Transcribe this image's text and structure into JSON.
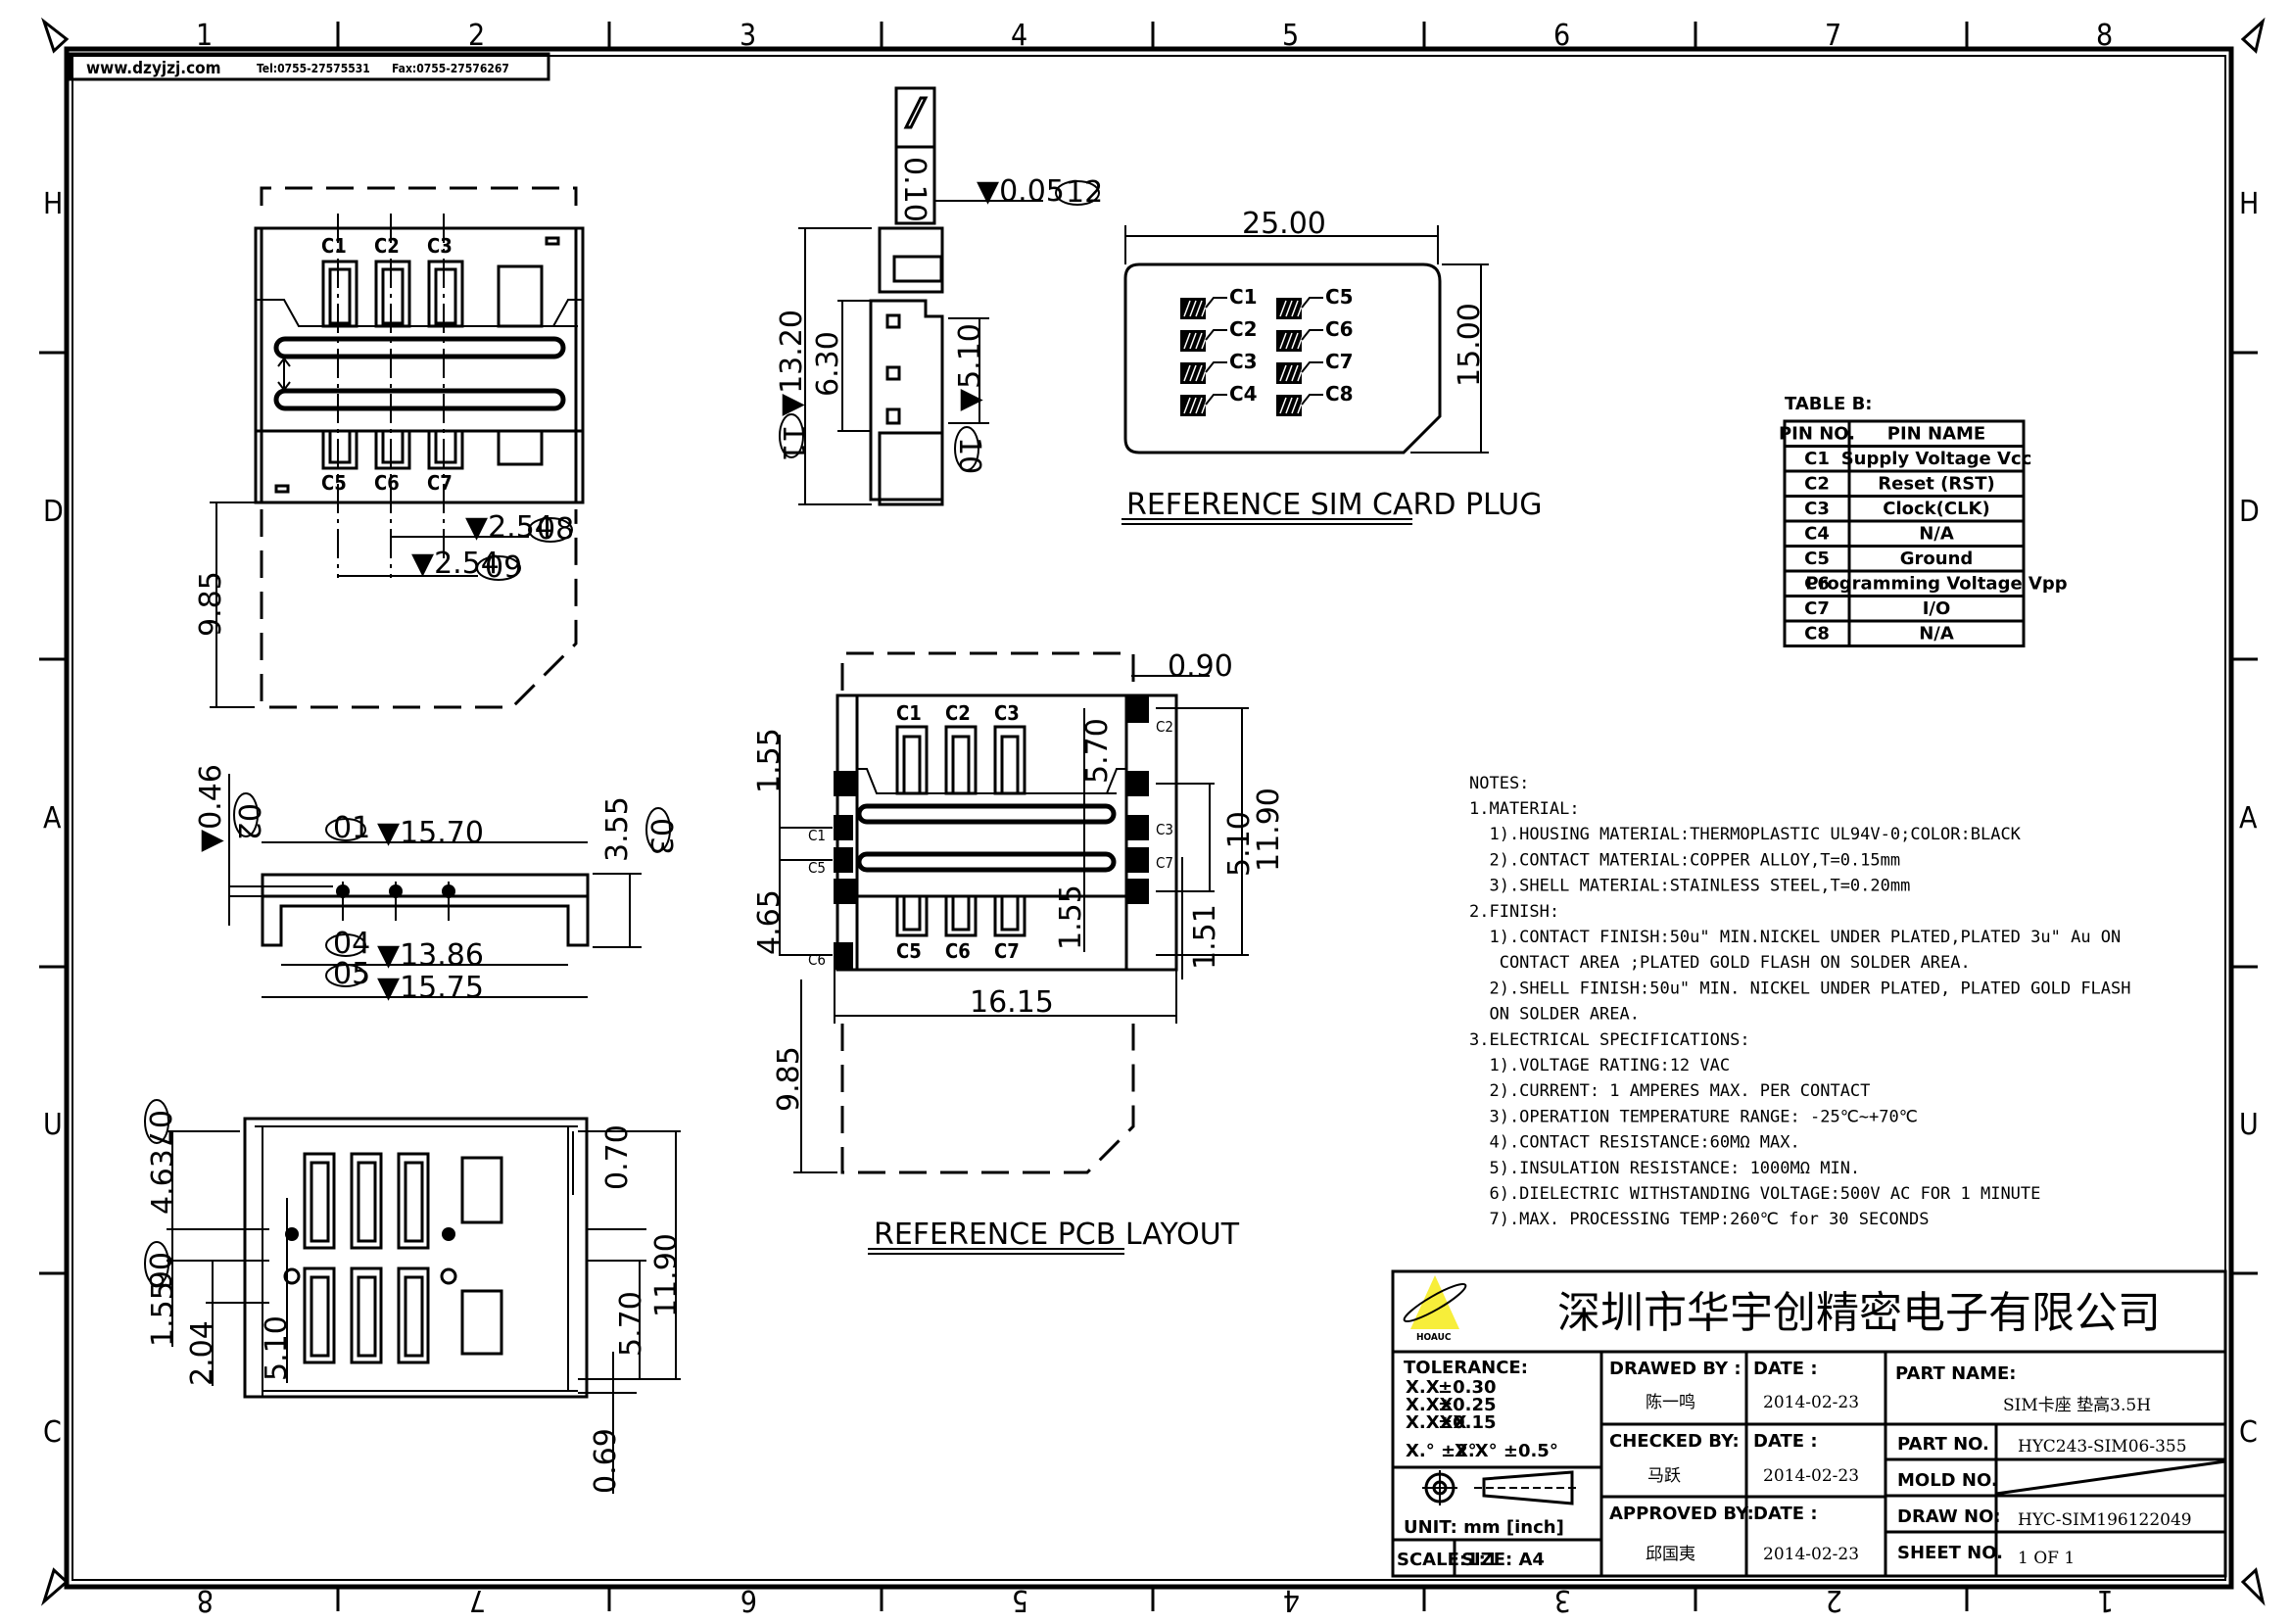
{
  "header": {
    "website": "www.dzyjzj.com",
    "tel": "Tel:0755-27575531",
    "fax": "Fax:0755-27576267"
  },
  "border": {
    "columns": [
      "1",
      "2",
      "3",
      "4",
      "5",
      "6",
      "7",
      "8"
    ],
    "columns_bottom": [
      "8",
      "7",
      "6",
      "5",
      "4",
      "3",
      "2",
      "1"
    ],
    "rows": [
      "H",
      "D",
      "A",
      "U",
      "C"
    ]
  },
  "top_view": {
    "pins_top": [
      "C1",
      "C2",
      "C3"
    ],
    "pins_bottom": [
      "C5",
      "C6",
      "C7"
    ],
    "dims": {
      "pitch1": "▼2.54",
      "pitch1_ref": "08",
      "pitch2": "▼2.54",
      "pitch2_ref": "09",
      "card_ext": "9.85"
    }
  },
  "side_view": {
    "flatness_symbol": "▱",
    "flatness_value": "0.10",
    "coplanarity": "▼0.05",
    "coplanarity_ref": "12",
    "height_total": "▼13.20",
    "height_total_ref": "11",
    "h1": "6.30",
    "h2": "▼5.10",
    "h2_ref": "10"
  },
  "sim_card": {
    "width": "25.00",
    "height": "15.00",
    "contacts_left": [
      "C1",
      "C2",
      "C3",
      "C4"
    ],
    "contacts_right": [
      "C5",
      "C6",
      "C7",
      "C8"
    ],
    "caption": "REFERENCE SIM CARD PLUG"
  },
  "table_b": {
    "title": "TABLE B:",
    "headers": [
      "PIN NO.",
      "PIN NAME"
    ],
    "rows": [
      [
        "C1",
        "Supply Voltage Vcc"
      ],
      [
        "C2",
        "Reset (RST)"
      ],
      [
        "C3",
        "Clock(CLK)"
      ],
      [
        "C4",
        "N/A"
      ],
      [
        "C5",
        "Ground"
      ],
      [
        "C6",
        "Programming Voltage Vpp"
      ],
      [
        "C7",
        "I/O"
      ],
      [
        "C8",
        "N/A"
      ]
    ]
  },
  "front_view": {
    "d1": "▼15.70",
    "d1_ref": "01",
    "d2": "▼0.46",
    "d2_ref": "02",
    "d3": "3.55",
    "d3_ref": "03",
    "d4": "▼13.86",
    "d4_ref": "04",
    "d5": "▼15.75",
    "d5_ref": "05"
  },
  "pcb_layout": {
    "pins_top": [
      "C1",
      "C2",
      "C3"
    ],
    "pins_bottom": [
      "C5",
      "C6",
      "C7"
    ],
    "side_left": [
      "C1",
      "C5",
      "C6"
    ],
    "side_right": [
      "C2",
      "C3",
      "C7"
    ],
    "dims": {
      "pad_w": "0.90",
      "l1": "1.55",
      "l2": "4.65",
      "m1": "5.70",
      "m2": "1.55",
      "r1": "5.10",
      "r2": "11.90",
      "r3": "1.51",
      "width": "16.15",
      "ext": "9.85"
    },
    "caption": "REFERENCE PCB LAYOUT"
  },
  "bottom_view": {
    "d07": "4.63",
    "d07_ref": "07",
    "d06": "1.55",
    "d06_ref": "06",
    "d2": "2.04",
    "d3": "5.10",
    "r1": "0.70",
    "r2": "11.90",
    "r3": "5.70",
    "r4": "0.69"
  },
  "notes": {
    "title": "NOTES:",
    "lines": [
      "1.MATERIAL:",
      "  1).HOUSING MATERIAL:THERMOPLASTIC UL94V-0;COLOR:BLACK",
      "  2).CONTACT MATERIAL:COPPER ALLOY,T=0.15mm",
      "  3).SHELL MATERIAL:STAINLESS STEEL,T=0.20mm",
      "2.FINISH:",
      "  1).CONTACT FINISH:50u\" MIN.NICKEL UNDER PLATED,PLATED 3u\" Au ON",
      "   CONTACT AREA ;PLATED GOLD FLASH ON SOLDER AREA.",
      "  2).SHELL FINISH:50u\" MIN. NICKEL UNDER PLATED, PLATED GOLD FLASH",
      "  ON SOLDER AREA.",
      "3.ELECTRICAL SPECIFICATIONS:",
      "  1).VOLTAGE RATING:12 VAC",
      "  2).CURRENT: 1 AMPERES MAX. PER CONTACT",
      "  3).OPERATION TEMPERATURE RANGE: -25℃~+70℃",
      "  4).CONTACT RESISTANCE:60MΩ MAX.",
      "  5).INSULATION RESISTANCE: 1000MΩ MIN.",
      "  6).DIELECTRIC WITHSTANDING VOLTAGE:500V AC FOR 1 MINUTE",
      "  7).MAX. PROCESSING TEMP:260℃ for 30 SECONDS"
    ]
  },
  "title_block": {
    "logo_text": "HOAUC",
    "company": "深圳市华宇创精密电子有限公司",
    "tolerance_label": "TOLERANCE:",
    "tolerances": [
      [
        "X.X",
        "±0.30"
      ],
      [
        "X.XX",
        "±0.25"
      ],
      [
        "X.XXX",
        "±0.15"
      ]
    ],
    "angle_tol": [
      "X.° ±2°",
      "X.X° ±0.5°"
    ],
    "unit": "UNIT: mm [inch]",
    "scale": "SCALE:1:1",
    "size": "SIZE: A4",
    "drawed_by_label": "DRAWED BY :",
    "drawed_by": "陈一鸣",
    "checked_by_label": "CHECKED BY:",
    "checked_by": "马跃",
    "approved_by_label": "APPROVED BY:",
    "approved_by": "邱国夷",
    "date_label": "DATE :",
    "dates": [
      "2014-02-23",
      "2014-02-23",
      "2014-02-23"
    ],
    "part_name_label": "PART NAME:",
    "part_name": "SIM卡座 垫高3.5H",
    "part_no_label": "PART NO.",
    "part_no": "HYC243-SIM06-355",
    "mold_no_label": "MOLD NO.",
    "draw_no_label": "DRAW NO:",
    "draw_no": "HYC-SIM196122049",
    "sheet_no_label": "SHEET NO.",
    "sheet_no": "1 OF 1"
  }
}
